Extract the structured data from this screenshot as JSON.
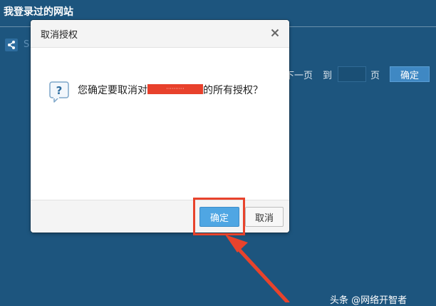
{
  "page": {
    "title": "我登录过的网站",
    "share_label": "S"
  },
  "pager": {
    "next_label": "下一页",
    "goto_label": "到",
    "page_value": "",
    "page_unit": "页",
    "confirm_label": "确定"
  },
  "dialog": {
    "title": "取消授权",
    "close_label": "×",
    "message_before": "您确定要取消对",
    "redacted_site": "··········",
    "message_after": "的所有授权？",
    "confirm_label": "确定",
    "cancel_label": "取消"
  },
  "watermark": {
    "text": "头条 @网络开智者"
  },
  "colors": {
    "background": "#1d557e",
    "annotation_red": "#e8432c",
    "primary_button": "#4fa6e3"
  },
  "icons": {
    "share": "share-icon",
    "close": "close-icon",
    "question": "question-icon",
    "arrow": "annotation-arrow-icon"
  }
}
